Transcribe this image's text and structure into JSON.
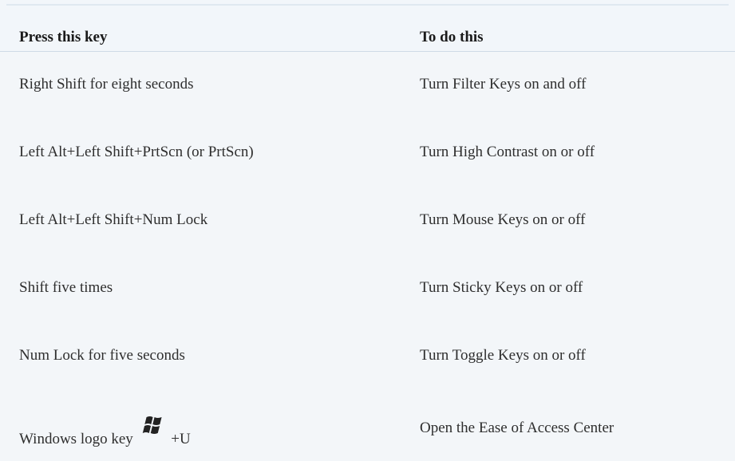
{
  "table": {
    "headers": {
      "key": "Press this key",
      "action": "To do this"
    },
    "rows": [
      {
        "key": "Right Shift for eight seconds",
        "action": "Turn Filter Keys on and off"
      },
      {
        "key": "Left Alt+Left Shift+PrtScn (or PrtScn)",
        "action": "Turn High Contrast on or off"
      },
      {
        "key": "Left Alt+Left Shift+Num Lock",
        "action": "Turn Mouse Keys on or off"
      },
      {
        "key": "Shift five times",
        "action": "Turn Sticky Keys on or off"
      },
      {
        "key": "Num Lock for five seconds",
        "action": "Turn Toggle Keys on or off"
      },
      {
        "key_prefix": "Windows logo key",
        "key_icon": "windows-logo-icon",
        "key_suffix": "+U",
        "action": "Open the Ease of Access Center"
      }
    ]
  }
}
